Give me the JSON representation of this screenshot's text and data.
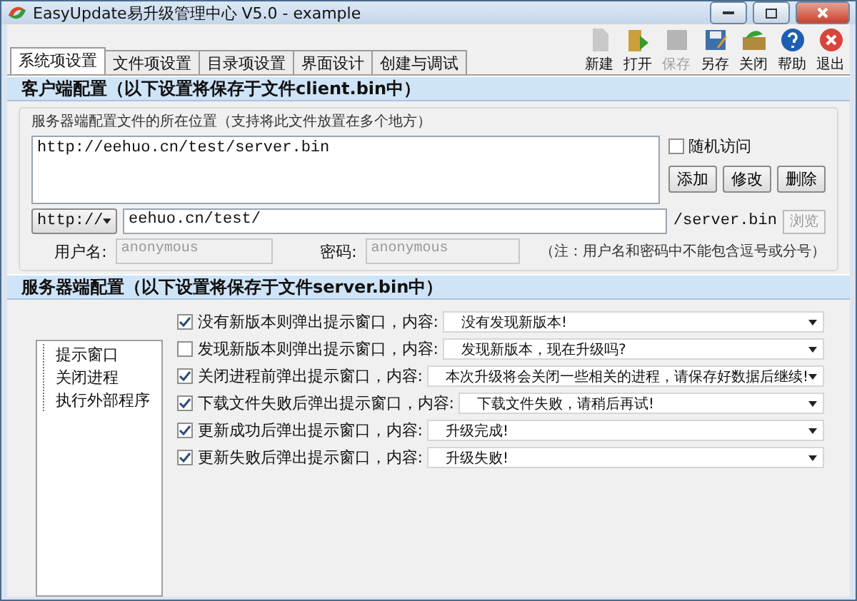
{
  "window": {
    "title": "EasyUpdate易升级管理中心 V5.0 - example"
  },
  "tabs": [
    {
      "label": "系统项设置",
      "selected": true
    },
    {
      "label": "文件项设置",
      "selected": false
    },
    {
      "label": "目录项设置",
      "selected": false
    },
    {
      "label": "界面设计",
      "selected": false
    },
    {
      "label": "创建与调试",
      "selected": false
    }
  ],
  "toolbar": [
    {
      "kind": "new",
      "label": "新建",
      "disabled": false
    },
    {
      "kind": "open",
      "label": "打开",
      "disabled": false
    },
    {
      "kind": "save",
      "label": "保存",
      "disabled": true
    },
    {
      "kind": "saveas",
      "label": "另存",
      "disabled": false
    },
    {
      "kind": "close",
      "label": "关闭",
      "disabled": false
    },
    {
      "kind": "help",
      "label": "帮助",
      "disabled": false
    },
    {
      "kind": "exit",
      "label": "退出",
      "disabled": false
    }
  ],
  "client": {
    "heading": "客户端配置（以下设置将保存于文件client.bin中）",
    "location_label": "服务器端配置文件的所在位置（支持将此文件放置在多个地方）",
    "locations": [
      "http://eehuo.cn/test/server.bin"
    ],
    "random_access": {
      "label": "随机访问",
      "checked": false
    },
    "buttons": [
      "添加",
      "修改",
      "删除"
    ],
    "protocol": "http://",
    "path": "eehuo.cn/test/",
    "file": "/server.bin",
    "browse": "浏览",
    "user_label": "用户名:",
    "user": "anonymous",
    "password_label": "密码:",
    "password": "anonymous",
    "note": "（注：用户名和密码中不能包含逗号或分号）"
  },
  "server": {
    "heading": "服务器端配置（以下设置将保存于文件server.bin中）",
    "tree": [
      "提示窗口",
      "关闭进程",
      "执行外部程序"
    ],
    "rules": [
      {
        "checked": true,
        "label": "没有新版本则弹出提示窗口，内容:",
        "value": "没有发现新版本!"
      },
      {
        "checked": false,
        "label": "发现新版本则弹出提示窗口，内容:",
        "value": "发现新版本，现在升级吗?"
      },
      {
        "checked": true,
        "label": "关闭进程前弹出提示窗口，内容:",
        "value": "本次升级将会关闭一些相关的进程，请保存好数据后继续!"
      },
      {
        "checked": true,
        "label": "下载文件失败后弹出提示窗口，内容:",
        "value": "下载文件失败，请稍后再试!"
      },
      {
        "checked": true,
        "label": "更新成功后弹出提示窗口，内容:",
        "value": "升级完成!"
      },
      {
        "checked": true,
        "label": "更新失败后弹出提示窗口，内容:",
        "value": "升级失败!"
      }
    ]
  }
}
